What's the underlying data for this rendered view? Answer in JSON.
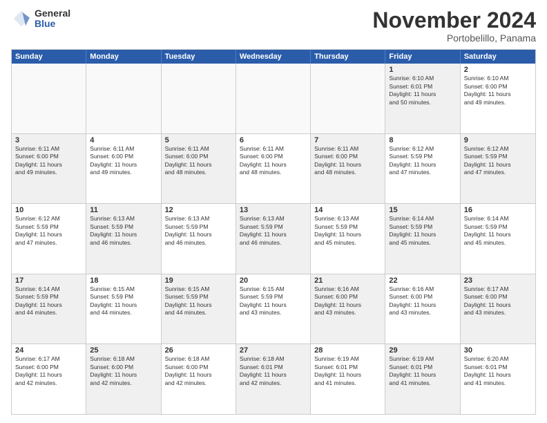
{
  "logo": {
    "general": "General",
    "blue": "Blue"
  },
  "title": "November 2024",
  "subtitle": "Portobelillo, Panama",
  "days": [
    "Sunday",
    "Monday",
    "Tuesday",
    "Wednesday",
    "Thursday",
    "Friday",
    "Saturday"
  ],
  "rows": [
    [
      {
        "day": "",
        "text": "",
        "empty": true
      },
      {
        "day": "",
        "text": "",
        "empty": true
      },
      {
        "day": "",
        "text": "",
        "empty": true
      },
      {
        "day": "",
        "text": "",
        "empty": true
      },
      {
        "day": "",
        "text": "",
        "empty": true
      },
      {
        "day": "1",
        "text": "Sunrise: 6:10 AM\nSunset: 6:01 PM\nDaylight: 11 hours\nand 50 minutes.",
        "shaded": true
      },
      {
        "day": "2",
        "text": "Sunrise: 6:10 AM\nSunset: 6:00 PM\nDaylight: 11 hours\nand 49 minutes.",
        "shaded": false
      }
    ],
    [
      {
        "day": "3",
        "text": "Sunrise: 6:11 AM\nSunset: 6:00 PM\nDaylight: 11 hours\nand 49 minutes.",
        "shaded": true
      },
      {
        "day": "4",
        "text": "Sunrise: 6:11 AM\nSunset: 6:00 PM\nDaylight: 11 hours\nand 49 minutes.",
        "shaded": false
      },
      {
        "day": "5",
        "text": "Sunrise: 6:11 AM\nSunset: 6:00 PM\nDaylight: 11 hours\nand 48 minutes.",
        "shaded": true
      },
      {
        "day": "6",
        "text": "Sunrise: 6:11 AM\nSunset: 6:00 PM\nDaylight: 11 hours\nand 48 minutes.",
        "shaded": false
      },
      {
        "day": "7",
        "text": "Sunrise: 6:11 AM\nSunset: 6:00 PM\nDaylight: 11 hours\nand 48 minutes.",
        "shaded": true
      },
      {
        "day": "8",
        "text": "Sunrise: 6:12 AM\nSunset: 5:59 PM\nDaylight: 11 hours\nand 47 minutes.",
        "shaded": false
      },
      {
        "day": "9",
        "text": "Sunrise: 6:12 AM\nSunset: 5:59 PM\nDaylight: 11 hours\nand 47 minutes.",
        "shaded": true
      }
    ],
    [
      {
        "day": "10",
        "text": "Sunrise: 6:12 AM\nSunset: 5:59 PM\nDaylight: 11 hours\nand 47 minutes.",
        "shaded": false
      },
      {
        "day": "11",
        "text": "Sunrise: 6:13 AM\nSunset: 5:59 PM\nDaylight: 11 hours\nand 46 minutes.",
        "shaded": true
      },
      {
        "day": "12",
        "text": "Sunrise: 6:13 AM\nSunset: 5:59 PM\nDaylight: 11 hours\nand 46 minutes.",
        "shaded": false
      },
      {
        "day": "13",
        "text": "Sunrise: 6:13 AM\nSunset: 5:59 PM\nDaylight: 11 hours\nand 46 minutes.",
        "shaded": true
      },
      {
        "day": "14",
        "text": "Sunrise: 6:13 AM\nSunset: 5:59 PM\nDaylight: 11 hours\nand 45 minutes.",
        "shaded": false
      },
      {
        "day": "15",
        "text": "Sunrise: 6:14 AM\nSunset: 5:59 PM\nDaylight: 11 hours\nand 45 minutes.",
        "shaded": true
      },
      {
        "day": "16",
        "text": "Sunrise: 6:14 AM\nSunset: 5:59 PM\nDaylight: 11 hours\nand 45 minutes.",
        "shaded": false
      }
    ],
    [
      {
        "day": "17",
        "text": "Sunrise: 6:14 AM\nSunset: 5:59 PM\nDaylight: 11 hours\nand 44 minutes.",
        "shaded": true
      },
      {
        "day": "18",
        "text": "Sunrise: 6:15 AM\nSunset: 5:59 PM\nDaylight: 11 hours\nand 44 minutes.",
        "shaded": false
      },
      {
        "day": "19",
        "text": "Sunrise: 6:15 AM\nSunset: 5:59 PM\nDaylight: 11 hours\nand 44 minutes.",
        "shaded": true
      },
      {
        "day": "20",
        "text": "Sunrise: 6:15 AM\nSunset: 5:59 PM\nDaylight: 11 hours\nand 43 minutes.",
        "shaded": false
      },
      {
        "day": "21",
        "text": "Sunrise: 6:16 AM\nSunset: 6:00 PM\nDaylight: 11 hours\nand 43 minutes.",
        "shaded": true
      },
      {
        "day": "22",
        "text": "Sunrise: 6:16 AM\nSunset: 6:00 PM\nDaylight: 11 hours\nand 43 minutes.",
        "shaded": false
      },
      {
        "day": "23",
        "text": "Sunrise: 6:17 AM\nSunset: 6:00 PM\nDaylight: 11 hours\nand 43 minutes.",
        "shaded": true
      }
    ],
    [
      {
        "day": "24",
        "text": "Sunrise: 6:17 AM\nSunset: 6:00 PM\nDaylight: 11 hours\nand 42 minutes.",
        "shaded": false
      },
      {
        "day": "25",
        "text": "Sunrise: 6:18 AM\nSunset: 6:00 PM\nDaylight: 11 hours\nand 42 minutes.",
        "shaded": true
      },
      {
        "day": "26",
        "text": "Sunrise: 6:18 AM\nSunset: 6:00 PM\nDaylight: 11 hours\nand 42 minutes.",
        "shaded": false
      },
      {
        "day": "27",
        "text": "Sunrise: 6:18 AM\nSunset: 6:01 PM\nDaylight: 11 hours\nand 42 minutes.",
        "shaded": true
      },
      {
        "day": "28",
        "text": "Sunrise: 6:19 AM\nSunset: 6:01 PM\nDaylight: 11 hours\nand 41 minutes.",
        "shaded": false
      },
      {
        "day": "29",
        "text": "Sunrise: 6:19 AM\nSunset: 6:01 PM\nDaylight: 11 hours\nand 41 minutes.",
        "shaded": true
      },
      {
        "day": "30",
        "text": "Sunrise: 6:20 AM\nSunset: 6:01 PM\nDaylight: 11 hours\nand 41 minutes.",
        "shaded": false
      }
    ]
  ]
}
